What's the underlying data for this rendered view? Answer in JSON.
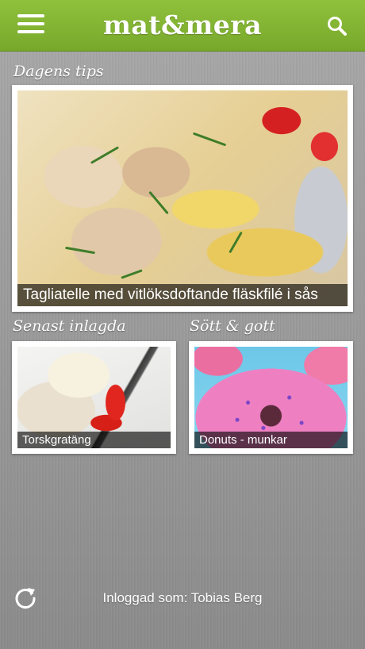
{
  "header": {
    "logo_text": "mat&mera",
    "menu_icon": "hamburger-menu-icon",
    "search_icon": "search-icon",
    "accent_color": "#7fb432"
  },
  "todays_tip": {
    "label": "Dagens tips",
    "recipe_title": "Tagliatelle med vitlöksdoftande fläskfilé i sås"
  },
  "latest": {
    "label": "Senast inlagda",
    "recipe_title": "Torskgratäng"
  },
  "sweet": {
    "label": "Sött & gott",
    "recipe_title": "Donuts - munkar"
  },
  "footer": {
    "refresh_icon": "refresh-icon",
    "logged_in_text": "Inloggad som: Tobias Berg"
  }
}
